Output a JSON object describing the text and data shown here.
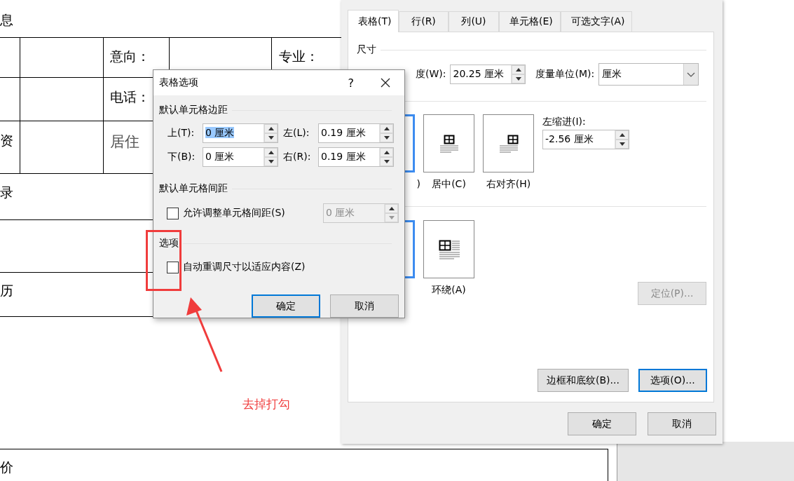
{
  "document": {
    "texts": [
      {
        "text": "息",
        "kind": "plain"
      },
      {
        "text": "意向：",
        "kind": "plain"
      },
      {
        "text": "专业：",
        "kind": "plain"
      },
      {
        "text": "电话：",
        "kind": "plain"
      },
      {
        "text": "资",
        "kind": "plain"
      },
      {
        "text": "居住",
        "kind": "muted"
      },
      {
        "text": "录",
        "kind": "plain"
      },
      {
        "text": "历",
        "kind": "plain"
      },
      {
        "text": "价",
        "kind": "plain"
      }
    ]
  },
  "table_properties": {
    "tabs": [
      {
        "label": "表格(T)",
        "selected": true
      },
      {
        "label": "行(R)",
        "selected": false
      },
      {
        "label": "列(U)",
        "selected": false
      },
      {
        "label": "单元格(E)",
        "selected": false
      },
      {
        "label": "可选文字(A)",
        "selected": false
      }
    ],
    "size": {
      "heading": "尺寸",
      "width_label": "度(W):",
      "width_value": "20.25 厘米",
      "unit_label": "度量单位(M):",
      "unit_value": "厘米"
    },
    "alignment": {
      "options": [
        {
          "kind": "left",
          "label": ")",
          "selected": true
        },
        {
          "kind": "center",
          "label": "居中(C)",
          "selected": false
        },
        {
          "kind": "right",
          "label": "右对齐(H)",
          "selected": false
        }
      ],
      "indent_label": "左缩进(I):",
      "indent_value": "-2.56 厘米"
    },
    "wrapping": {
      "options": [
        {
          "kind": "none",
          "selected": true
        },
        {
          "kind": "around",
          "label": "环绕(A)",
          "selected": false
        }
      ]
    },
    "position_button": {
      "label": "定位(P)...",
      "disabled": true
    },
    "buttons": [
      {
        "label": "边框和底纹(B)...",
        "focused": false
      },
      {
        "label": "选项(O)...",
        "focused": true
      }
    ],
    "footer_buttons": [
      {
        "label": "确定",
        "focused": false
      },
      {
        "label": "取消",
        "focused": false
      }
    ]
  },
  "table_options": {
    "title": "表格选项",
    "help": "?",
    "margins": {
      "heading": "默认单元格边距",
      "fields": [
        {
          "label": "上(T):",
          "value": "0 厘米",
          "highlighted": true
        },
        {
          "label": "左(L):",
          "value": "0.19 厘米",
          "highlighted": false
        },
        {
          "label": "下(B):",
          "value": "0 厘米",
          "highlighted": false
        },
        {
          "label": "右(R):",
          "value": "0.19 厘米",
          "highlighted": false
        }
      ]
    },
    "spacing": {
      "heading": "默认单元格间距",
      "checkbox": {
        "label": "允许调整单元格间距(S)",
        "checked": false
      },
      "value": "0 厘米",
      "disabled": true
    },
    "options": {
      "heading": "选项",
      "checkbox": {
        "label": "自动重调尺寸以适应内容(Z)",
        "checked": false
      }
    },
    "buttons": [
      {
        "label": "确定",
        "focused": true
      },
      {
        "label": "取消",
        "focused": false
      }
    ]
  },
  "annotation": {
    "note": "去掉打勾"
  }
}
